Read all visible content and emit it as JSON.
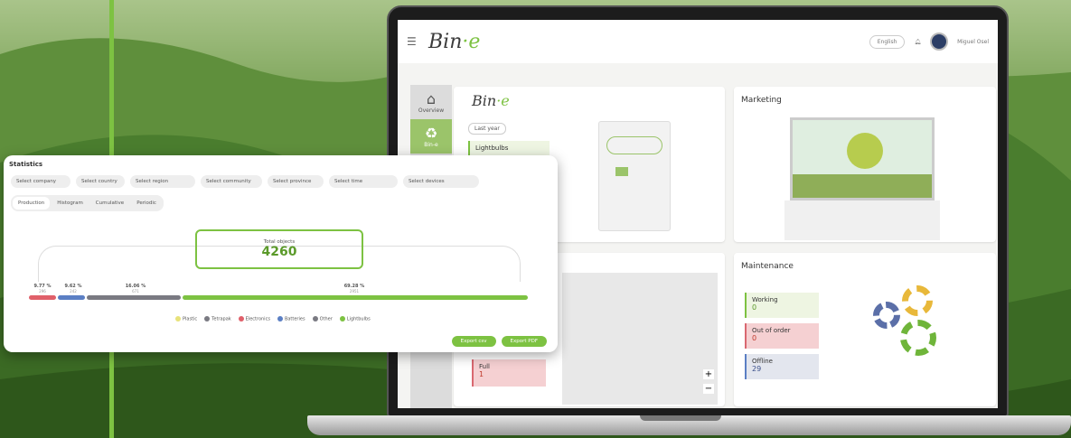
{
  "app": {
    "logo_text": "Bin",
    "logo_suffix": "·e",
    "menu_icon": "hamburger-icon"
  },
  "topbar": {
    "language": "English",
    "user": "Miguel Osel"
  },
  "sidebar": {
    "items": [
      {
        "label": "Overview",
        "icon": "home-icon",
        "active": false
      },
      {
        "label": "Bin-e",
        "icon": "recycle-icon",
        "active": true
      }
    ]
  },
  "overview_card": {
    "period": "Last year",
    "lightbulbs_label": "Lightbulbs"
  },
  "marketing_card": {
    "title": "Marketing"
  },
  "maintenance_card": {
    "title": "Maintenance",
    "working_label": "Working",
    "working_value": "0",
    "out_of_order_label": "Out of order",
    "out_of_order_value": "0",
    "offline_label": "Offline",
    "offline_value": "29"
  },
  "map_card": {
    "full_label": "Full",
    "full_value": "1",
    "zoom_in": "+",
    "zoom_out": "−"
  },
  "statistics": {
    "title": "Statistics",
    "filters": [
      "Select company",
      "Select country",
      "Select region",
      "Select community",
      "Select province",
      "Select time",
      "Select devices"
    ],
    "tabs": [
      "Production",
      "Histogram",
      "Cumulative",
      "Periodic"
    ],
    "total_label": "Total objects",
    "total_value": "4260",
    "segments": [
      {
        "pct": "9.77 %",
        "count": "296",
        "color": "#e0606a"
      },
      {
        "pct": "9.62 %",
        "count": "242",
        "color": "#5b7fc4"
      },
      {
        "pct": "16.06 %",
        "count": "671",
        "color": "#7a7a82"
      },
      {
        "pct": "69.28 %",
        "count": "2951",
        "color": "#7dc242"
      }
    ],
    "legend": [
      {
        "label": "Plastic",
        "color": "#e8e27a"
      },
      {
        "label": "Tetrapak",
        "color": "#7a7a82"
      },
      {
        "label": "Electronics",
        "color": "#e0606a"
      },
      {
        "label": "Batteries",
        "color": "#5b7fc4"
      },
      {
        "label": "Other",
        "color": "#7a7a82"
      },
      {
        "label": "Lightbulbs",
        "color": "#7dc242"
      }
    ],
    "export_csv": "Export csv",
    "export_pdf": "Export PDF"
  },
  "colors": {
    "accent": "#7dc242",
    "dark": "#333333"
  }
}
